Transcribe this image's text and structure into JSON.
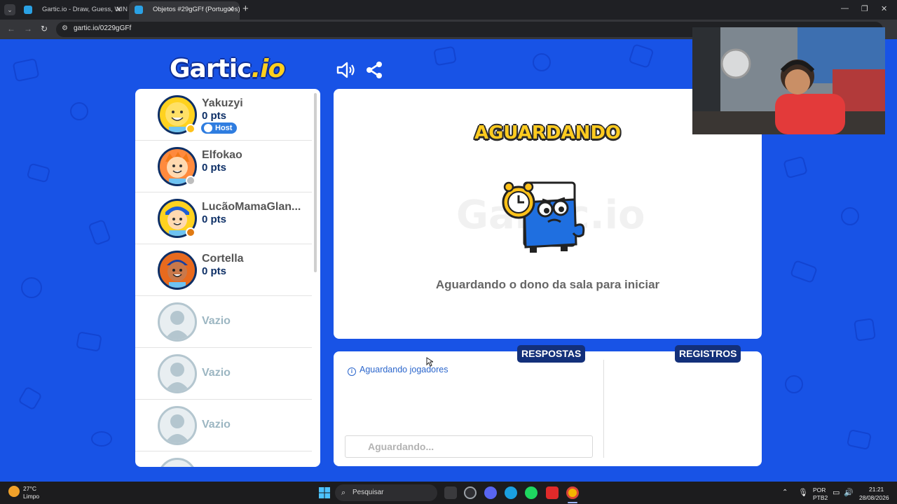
{
  "browser": {
    "tabs": [
      {
        "title": "Gartic.io - Draw, Guess, WIN",
        "active": false
      },
      {
        "title": "Objetos #29gGFf (Português) -",
        "active": true
      }
    ],
    "url": "gartic.io/0229gGFf"
  },
  "brand": {
    "logo_main": "Gartic",
    "logo_suffix": ".io"
  },
  "players": [
    {
      "name": "Yakuzyi",
      "points": "0 pts",
      "badge": "Host",
      "status_color": "#ffc21a"
    },
    {
      "name": "Elfokao",
      "points": "0 pts",
      "status_color": "#bdbdbd"
    },
    {
      "name": "LucãoMamaGlan...",
      "points": "0 pts",
      "status_color": "#e07a12"
    },
    {
      "name": "Cortella",
      "points": "0 pts"
    },
    {
      "name": "Vazio"
    },
    {
      "name": "Vazio"
    },
    {
      "name": "Vazio"
    }
  ],
  "main": {
    "title": "AGUARDANDO",
    "watermark": "Gartic.io",
    "message": "Aguardando o dono da sala para iniciar"
  },
  "bottom": {
    "answers_tab": "RESPOSTAS",
    "logs_tab": "REGISTROS",
    "status": "Aguardando jogadores",
    "input_placeholder": "Aguardando..."
  },
  "taskbar": {
    "weather_temp": "27°C",
    "weather_desc": "Limpo",
    "search": "Pesquisar",
    "lang": "POR",
    "layout": "PTB2",
    "time": "21:21",
    "date": "28/08/2026"
  },
  "colors": {
    "page_bg": "#1853e6",
    "navy": "#13307a",
    "accent_yellow": "#ffcb1f",
    "link_blue": "#2b66cc"
  }
}
